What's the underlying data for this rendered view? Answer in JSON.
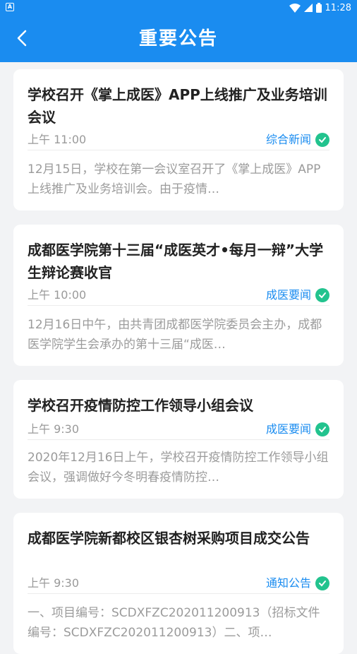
{
  "status_bar": {
    "time": "11:28"
  },
  "header": {
    "title": "重要公告"
  },
  "articles": [
    {
      "title": "学校召开《掌上成医》APP上线推广及业务培训会议",
      "time": "上午 11:00",
      "category": "综合新闻",
      "summary": "12月15日，学校在第一会议室召开了《掌上成医》APP上线推广及业务培训会。由于疫情…"
    },
    {
      "title": "成都医学院第十三届“成医英才•每月一辩”大学生辩论赛收官",
      "time": "上午 10:00",
      "category": "成医要闻",
      "summary": "12月16日中午，由共青团成都医学院委员会主办，成都医学院学生会承办的第十三届“成医…"
    },
    {
      "title": "学校召开疫情防控工作领导小组会议",
      "time": "上午 9:30",
      "category": "成医要闻",
      "summary": "2020年12月16日上午，学校召开疫情防控工作领导小组会议，强调做好今冬明春疫情防控…"
    },
    {
      "title": "成都医学院新都校区银杏树采购项目成交公告",
      "time": "上午 9:30",
      "category": "通知公告",
      "summary": "一、项目编号：SCDXFZC202011200913（招标文件编号：SCDXFZC202011200913）二、项…"
    }
  ]
}
